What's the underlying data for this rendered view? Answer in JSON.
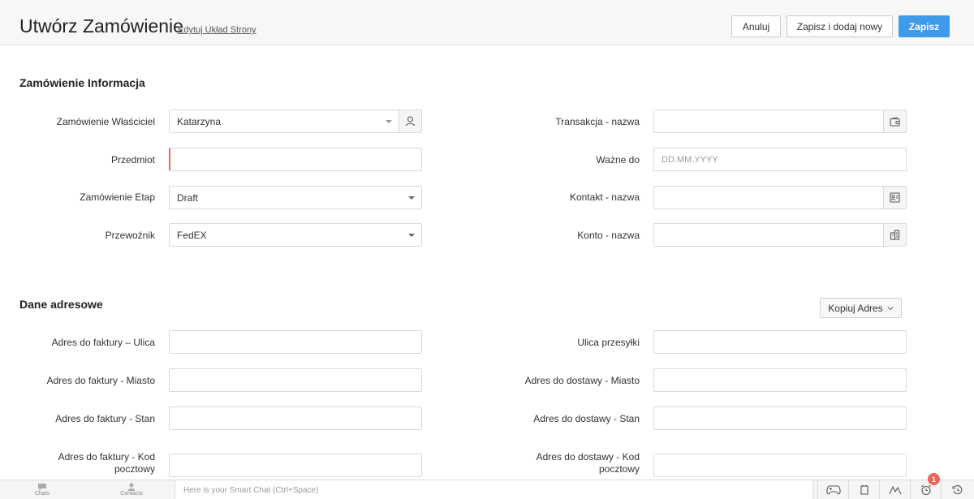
{
  "header": {
    "title": "Utwórz Zamówienie",
    "edit_layout": "Edytuj Układ Strony",
    "cancel": "Anuluj",
    "save_new": "Zapisz i dodaj nowy",
    "save": "Zapisz"
  },
  "order_info": {
    "title": "Zamówienie Informacja",
    "owner": {
      "label": "Zamówienie Właściciel",
      "value": "Katarzyna"
    },
    "subject": {
      "label": "Przedmiot",
      "value": ""
    },
    "stage": {
      "label": "Zamówienie Etap",
      "value": "Draft"
    },
    "carrier": {
      "label": "Przewoźnik",
      "value": "FedEX"
    },
    "deal_name": {
      "label": "Transakcja - nazwa",
      "value": ""
    },
    "valid_till": {
      "label": "Ważne do",
      "placeholder": "DD.MM.YYYY"
    },
    "contact_name": {
      "label": "Kontakt - nazwa",
      "value": ""
    },
    "account_name": {
      "label": "Konto - nazwa",
      "value": ""
    }
  },
  "address": {
    "title": "Dane adresowe",
    "copy_button": "Kopiuj Adres",
    "billing_street": "Adres do faktury – Ulica",
    "billing_city": "Adres do faktury - Miasto",
    "billing_state": "Adres do faktury - Stan",
    "billing_code": "Adres do faktury - Kod pocztowy",
    "shipping_street": "Ulica przesyłki",
    "shipping_city": "Adres do dostawy - Miasto",
    "shipping_state": "Adres do dostawy - Stan",
    "shipping_code": "Adres do dostawy - Kod pocztowy"
  },
  "footer": {
    "chats": "Chats",
    "contacts": "Contacts",
    "smart_chat_placeholder": "Here is your Smart Chat (Ctrl+Space)",
    "notification_count": "1"
  },
  "colors": {
    "primary": "#3d9be9",
    "error": "#e8665a"
  }
}
